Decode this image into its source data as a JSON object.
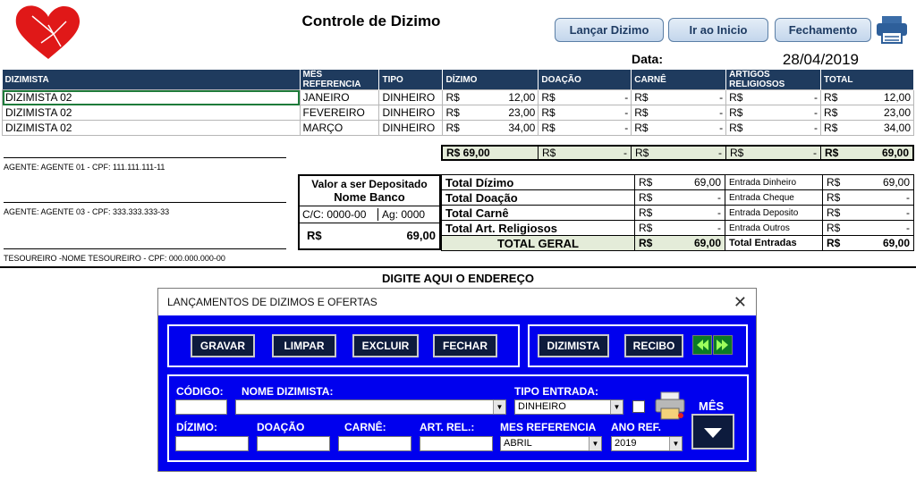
{
  "header": {
    "title": "Controle de Dizimo",
    "buttons": [
      "Lançar Dizimo",
      "Ir ao Inicio",
      "Fechamento"
    ],
    "date_label": "Data:",
    "date_value": "28/04/2019"
  },
  "grid": {
    "columns": [
      "DIZIMISTA",
      "MÊS REFERENCIA",
      "TIPO",
      "DÍZIMO",
      "DOAÇÃO",
      "CARNÊ",
      "ARTIGOS RELIGIOSOS",
      "TOTAL"
    ],
    "currency": "R$",
    "dash": "-",
    "rows": [
      {
        "name": "DIZIMISTA 02",
        "month": "JANEIRO",
        "type": "DINHEIRO",
        "dizimo": "12,00",
        "total": "12,00"
      },
      {
        "name": "DIZIMISTA 02",
        "month": "FEVEREIRO",
        "type": "DINHEIRO",
        "dizimo": "23,00",
        "total": "23,00"
      },
      {
        "name": "DIZIMISTA 02",
        "month": "MARÇO",
        "type": "DINHEIRO",
        "dizimo": "34,00",
        "total": "34,00"
      }
    ],
    "totals": {
      "dizimo": "R$ 69,00",
      "total": "69,00"
    }
  },
  "agents": [
    "AGENTE: AGENTE 01 - CPF: 111.111.111-11",
    "AGENTE: AGENTE 03 - CPF: 333.333.333-33",
    "TESOUREIRO -NOME TESOUREIRO - CPF: 000.000.000-00"
  ],
  "deposit": {
    "label": "Valor a ser Depositado",
    "bank": "Nome Banco",
    "account": "C/C: 0000-00",
    "agency": "Ag: 0000",
    "currency": "R$",
    "value": "69,00"
  },
  "summary": {
    "rows": [
      {
        "label": "Total Dízimo",
        "value": "69,00",
        "entry": "Entrada Dinheiro",
        "entry_value": "69,00"
      },
      {
        "label": "Total Doação",
        "value": "-",
        "entry": "Entrada Cheque",
        "entry_value": "-"
      },
      {
        "label": "Total Carnê",
        "value": "-",
        "entry": "Entrada Deposito",
        "entry_value": "-"
      },
      {
        "label": "Total Art. Religiosos",
        "value": "-",
        "entry": "Entrada Outros",
        "entry_value": "-"
      }
    ],
    "grand_label": "TOTAL GERAL",
    "grand_value": "69,00",
    "entries_label": "Total Entradas",
    "entries_value": "69,00"
  },
  "address": "DIGITE AQUI O ENDEREÇO",
  "dialog": {
    "title": "LANÇAMENTOS DE DIZIMOS E OFERTAS",
    "close": "✕",
    "buttons": {
      "gravar": "GRAVAR",
      "limpar": "LIMPAR",
      "excluir": "EXCLUIR",
      "fechar": "FECHAR",
      "dizimista": "DIZIMISTA",
      "recibo": "RECIBO"
    },
    "labels": {
      "codigo": "CÓDIGO:",
      "nome": "NOME DIZIMISTA:",
      "tipo": "TIPO ENTRADA:",
      "dizimo": "DÍZIMO:",
      "doacao": "DOAÇÃO",
      "carne": "CARNÊ:",
      "artrel": "ART. REL.:",
      "mesref": "MES REFERENCIA",
      "anoref": "ANO REF.",
      "mes": "MÊS"
    },
    "values": {
      "tipo": "DINHEIRO",
      "mesref": "ABRIL",
      "anoref": "2019"
    },
    "colors": {
      "dialog_bg": "#0000ee",
      "header_bg": "#1f3b5e"
    }
  }
}
